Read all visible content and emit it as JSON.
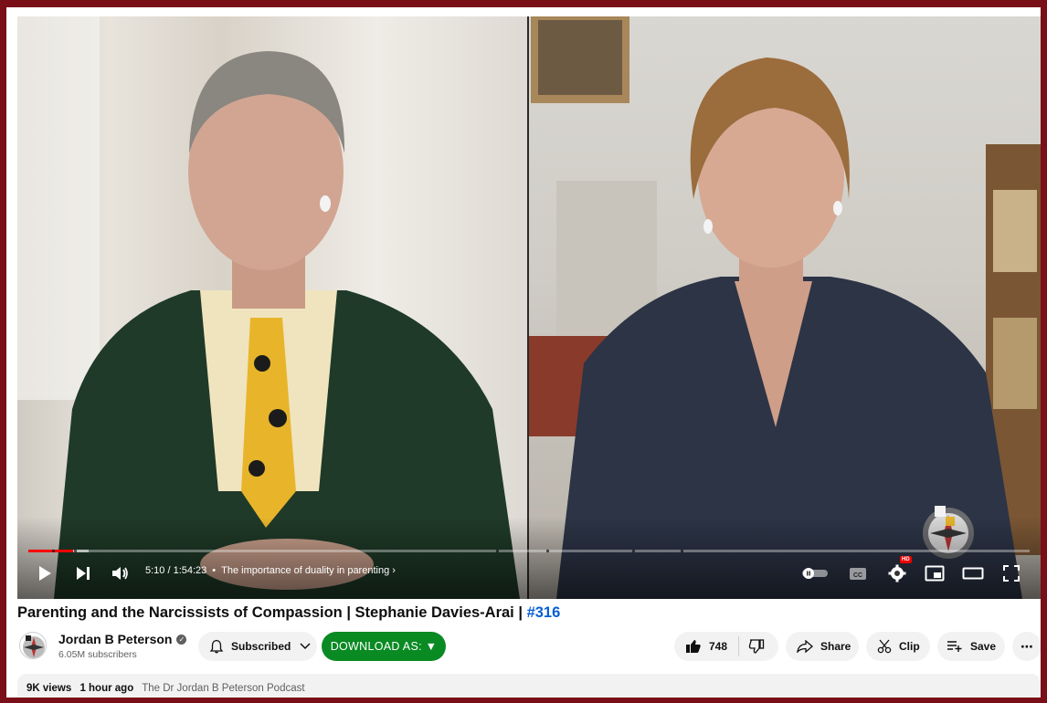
{
  "player": {
    "current_time": "5:10",
    "duration": "1:54:23",
    "time_display": "5:10 / 1:54:23",
    "chapter_title": "The importance of duality in parenting",
    "progress_fraction": 0.045,
    "buffer_fraction": 0.06,
    "icons": {
      "play": "play-icon",
      "next": "next-icon",
      "volume": "volume-icon",
      "autoplay": "autoplay-toggle",
      "captions": "cc-icon",
      "settings": "gear-icon",
      "hd": "HD",
      "miniplayer": "miniplayer-icon",
      "theater": "theater-icon",
      "fullscreen": "fullscreen-icon"
    },
    "accent_color": "#ff0000"
  },
  "video": {
    "title_main": "Parenting and the Narcissists of Compassion | Stephanie Davies-Arai | ",
    "title_tag": "#316"
  },
  "channel": {
    "name": "Jordan B Peterson",
    "subscribers": "6.05M subscribers"
  },
  "actions": {
    "subscribed_label": "Subscribed",
    "download_label": "DOWNLOAD AS: ▼",
    "like_count": "748",
    "share_label": "Share",
    "clip_label": "Clip",
    "save_label": "Save",
    "more_label": "⋯"
  },
  "description": {
    "views": "9K views",
    "time_ago": "1 hour ago",
    "playlist": "The Dr Jordan B Peterson Podcast"
  },
  "colors": {
    "border": "#7a0f17",
    "download_button": "#0a8a23",
    "hashtag": "#065fd4"
  }
}
